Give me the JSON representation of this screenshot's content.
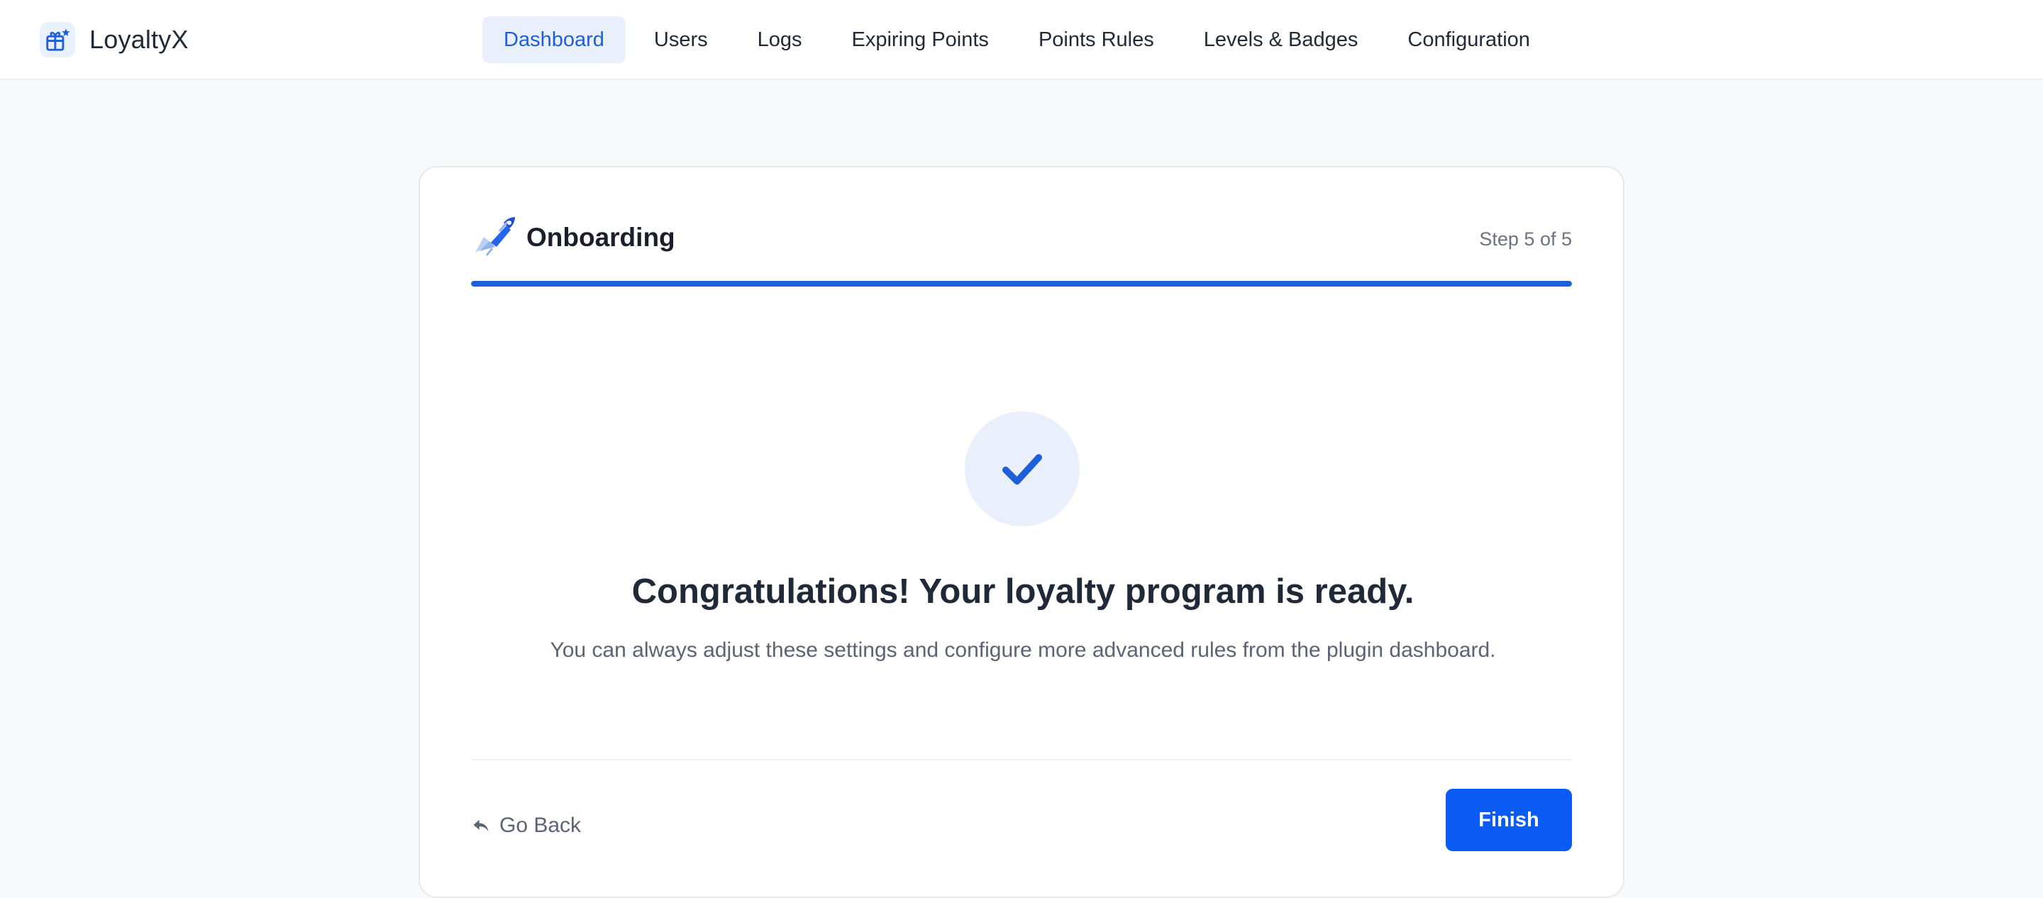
{
  "brand": {
    "name": "LoyaltyX",
    "logo_icon": "gift-icon"
  },
  "nav": {
    "items": [
      {
        "label": "Dashboard",
        "active": true
      },
      {
        "label": "Users",
        "active": false
      },
      {
        "label": "Logs",
        "active": false
      },
      {
        "label": "Expiring Points",
        "active": false
      },
      {
        "label": "Points Rules",
        "active": false
      },
      {
        "label": "Levels & Badges",
        "active": false
      },
      {
        "label": "Configuration",
        "active": false
      }
    ]
  },
  "onboarding": {
    "icon": "rocket-icon",
    "title": "Onboarding",
    "step_label": "Step 5 of 5",
    "progress": 1.0,
    "success_icon": "check-icon",
    "headline": "Congratulations! Your loyalty program is ready.",
    "description": "You can always adjust these settings and configure more advanced rules from the plugin dashboard.",
    "back_label": "Go Back",
    "back_icon": "reply-arrow-icon",
    "finish_label": "Finish"
  },
  "colors": {
    "accent": "#1d5fd8",
    "primary_button": "#0a5cf5",
    "active_nav_bg": "#eaf0fb"
  }
}
